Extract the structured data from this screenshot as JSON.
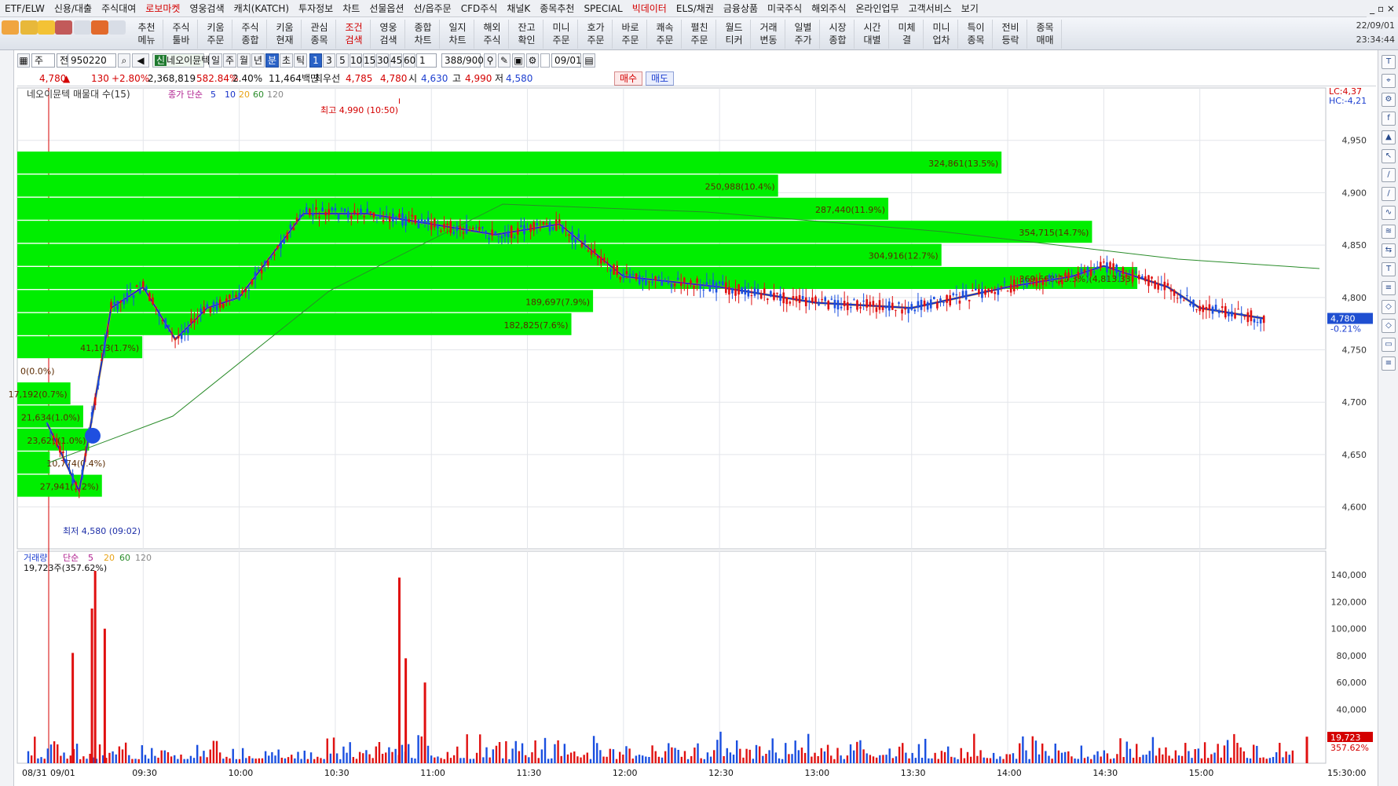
{
  "menu": [
    "ETF/ELW",
    "신용/대출",
    "주식대여",
    "로보마켓",
    "영웅검색",
    "캐치(KATCH)",
    "투자정보",
    "차트",
    "선물옵션",
    "선/옵주문",
    "CFD주식",
    "채널K",
    "종목추천",
    "SPECIAL",
    "빅데이터",
    "ELS/채권",
    "금융상품",
    "미국주식",
    "해외주식",
    "온라인업무",
    "고객서비스",
    "보기"
  ],
  "menu_red": [
    "로보마켓",
    "빅데이터"
  ],
  "window_controls": "_ ▫ ×",
  "toolbar_buttons": [
    {
      "l1": "추천",
      "l2": "메뉴"
    },
    {
      "l1": "주식",
      "l2": "툴바"
    },
    {
      "l1": "키움",
      "l2": "주문"
    },
    {
      "l1": "주식",
      "l2": "종합"
    },
    {
      "l1": "키움",
      "l2": "현재"
    },
    {
      "l1": "관심",
      "l2": "종목"
    },
    {
      "l1": "조건",
      "l2": "검색",
      "red": true
    },
    {
      "l1": "영웅",
      "l2": "검색"
    },
    {
      "l1": "종합",
      "l2": "차트"
    },
    {
      "l1": "일지",
      "l2": "차트"
    },
    {
      "l1": "해외",
      "l2": "주식"
    },
    {
      "l1": "잔고",
      "l2": "확인"
    },
    {
      "l1": "미니",
      "l2": "주문"
    },
    {
      "l1": "호가",
      "l2": "주문"
    },
    {
      "l1": "바로",
      "l2": "주문"
    },
    {
      "l1": "쾌속",
      "l2": "주문"
    },
    {
      "l1": "펼친",
      "l2": "주문"
    },
    {
      "l1": "월드",
      "l2": "티커"
    },
    {
      "l1": "거래",
      "l2": "변동"
    },
    {
      "l1": "일별",
      "l2": "주가"
    },
    {
      "l1": "시장",
      "l2": "종합"
    },
    {
      "l1": "시간",
      "l2": "대별"
    },
    {
      "l1": "미체",
      "l2": "결"
    },
    {
      "l1": "미니",
      "l2": "업차"
    },
    {
      "l1": "특이",
      "l2": "종목"
    },
    {
      "l1": "전비",
      "l2": "등락"
    },
    {
      "l1": "종목",
      "l2": "매매"
    }
  ],
  "clock": {
    "date": "22/09/01",
    "time": "23:34:44"
  },
  "controls": {
    "type": "주",
    "range": "전",
    "code": "950220",
    "name": "네오이뮨텍",
    "periods": [
      "일",
      "주",
      "월",
      "년",
      "분",
      "초",
      "틱"
    ],
    "selected_period": "분",
    "minutes": [
      "1",
      "3",
      "5",
      "10",
      "15",
      "30",
      "45",
      "60"
    ],
    "selected_minute": "1",
    "count": "1",
    "view": "388/900",
    "date": "09/01"
  },
  "quote": {
    "price": "4,780",
    "arrow": "▲",
    "change": "130",
    "rate": "+2.80%",
    "volume": "2,368,819",
    "vol_rate": "582.84%",
    "turnover": "2.40%",
    "amount": "11,464백만",
    "best_label": "최우선",
    "best_ask": "4,785",
    "best_bid": "4,780",
    "open_label": "시",
    "open": "4,630",
    "high_label": "고",
    "high": "4,990",
    "low_label": "저",
    "low": "4,580",
    "buy_label": "매수",
    "sell_label": "매도"
  },
  "price_panel": {
    "title": "네오이뮨텍 매물대 수(15)",
    "legend_prefix": "종가 단순",
    "ma_periods": [
      "5",
      "10",
      "20",
      "60",
      "120"
    ],
    "ma_colors": [
      "#1530c8",
      "#e8a317",
      "#2a8c2a",
      "#888888"
    ],
    "lc": "LC:4,37",
    "hc": "HC:-4,21",
    "current_price": "4,780",
    "current_change": "-0.21%",
    "high_annot": "최고 4,990 (10:50)",
    "low_annot": "최저 4,580 (09:02)",
    "profile_bars": [
      {
        "price": 4915,
        "label": "324,861(13.5%)",
        "frac": 1.0
      },
      {
        "price": 4892,
        "label": "250,988(10.4%)",
        "frac": 0.773
      },
      {
        "price": 4869,
        "label": "287,440(11.9%)",
        "frac": 0.885
      },
      {
        "price": 4846,
        "label": "354,715(14.7%)",
        "frac": 1.092
      },
      {
        "price": 4822,
        "label": "304,916(12.7%)",
        "frac": 0.939
      },
      {
        "price": 4799,
        "label": "369,668(15.3%)(4,813.33)",
        "frac": 1.138
      },
      {
        "price": 4776,
        "label": "189,697(7.9%)",
        "frac": 0.585
      },
      {
        "price": 4753,
        "label": "182,825(7.6%)",
        "frac": 0.563
      },
      {
        "price": 4730,
        "label": "41,103(1.7%)",
        "frac": 0.127
      },
      {
        "price": 4707,
        "label": "0(0.0%)",
        "frac": 0.0
      },
      {
        "price": 4684,
        "label": "17,192(0.7%)",
        "frac": 0.054
      },
      {
        "price": 4661,
        "label": "21,634(1.0%)",
        "frac": 0.067
      },
      {
        "price": 4638,
        "label": "23,629(1.0%)",
        "frac": 0.073
      },
      {
        "price": 4615,
        "label": "10,774(0.4%)",
        "frac": 0.033
      },
      {
        "price": 4592,
        "label": "27,941(1.2%)",
        "frac": 0.086
      }
    ],
    "yaxis_ticks": [
      "4,600",
      "4,650",
      "4,700",
      "4,750",
      "4,800",
      "4,850",
      "4,900",
      "4,950"
    ]
  },
  "volume_panel": {
    "title": "거래량",
    "legend_prefix": "단순",
    "ma_periods": [
      "5",
      "20",
      "60",
      "120"
    ],
    "current": "19,723주(357.62%)",
    "current_badge": "19,723",
    "current_badge_rate": "357.62%",
    "yaxis_ticks": [
      "40,000",
      "60,000",
      "80,000",
      "100,000",
      "120,000",
      "140,000"
    ]
  },
  "xaxis_labels": [
    "08/31",
    "09/01",
    "09:30",
    "10:00",
    "10:30",
    "11:00",
    "11:30",
    "12:00",
    "12:30",
    "13:00",
    "13:30",
    "14:00",
    "14:30",
    "15:00",
    "15:30:00"
  ],
  "chart_data": {
    "type": "candlestick",
    "symbol": "950220",
    "name": "네오이뮨텍",
    "interval": "1분",
    "date": "09/01",
    "ohlc_summary": {
      "open": 4630,
      "high": 4990,
      "low": 4580,
      "close": 4780,
      "change": 130,
      "change_rate": "+2.80%"
    },
    "y_ticks": [
      4600,
      4650,
      4700,
      4750,
      4800,
      4850,
      4900,
      4950
    ],
    "ylim": [
      4560,
      5000
    ],
    "x_ticks": [
      "09:30",
      "10:00",
      "10:30",
      "11:00",
      "11:30",
      "12:00",
      "12:30",
      "13:00",
      "13:30",
      "14:00",
      "14:30",
      "15:00",
      "15:30:00"
    ],
    "ma5_trend": [
      {
        "t": "09:00",
        "v": 4680
      },
      {
        "t": "09:10",
        "v": 4615
      },
      {
        "t": "09:20",
        "v": 4790
      },
      {
        "t": "09:30",
        "v": 4810
      },
      {
        "t": "09:40",
        "v": 4760
      },
      {
        "t": "09:50",
        "v": 4790
      },
      {
        "t": "10:00",
        "v": 4800
      },
      {
        "t": "10:20",
        "v": 4880
      },
      {
        "t": "10:40",
        "v": 4880
      },
      {
        "t": "11:00",
        "v": 4870
      },
      {
        "t": "11:20",
        "v": 4860
      },
      {
        "t": "11:40",
        "v": 4870
      },
      {
        "t": "12:00",
        "v": 4820
      },
      {
        "t": "12:30",
        "v": 4810
      },
      {
        "t": "13:00",
        "v": 4795
      },
      {
        "t": "13:30",
        "v": 4790
      },
      {
        "t": "14:00",
        "v": 4810
      },
      {
        "t": "14:20",
        "v": 4820
      },
      {
        "t": "14:30",
        "v": 4830
      },
      {
        "t": "14:50",
        "v": 4810
      },
      {
        "t": "15:00",
        "v": 4790
      },
      {
        "t": "15:20",
        "v": 4780
      }
    ],
    "volume_max_ticks": [
      40000,
      60000,
      80000,
      100000,
      120000,
      140000
    ],
    "volume_last": 19723,
    "volume_spikes": [
      {
        "t": "09:08",
        "v": 82000
      },
      {
        "t": "09:14",
        "v": 115000
      },
      {
        "t": "09:15",
        "v": 143000
      },
      {
        "t": "09:18",
        "v": 100000
      },
      {
        "t": "10:50",
        "v": 138000
      },
      {
        "t": "10:52",
        "v": 78000
      },
      {
        "t": "10:58",
        "v": 60000
      }
    ]
  }
}
